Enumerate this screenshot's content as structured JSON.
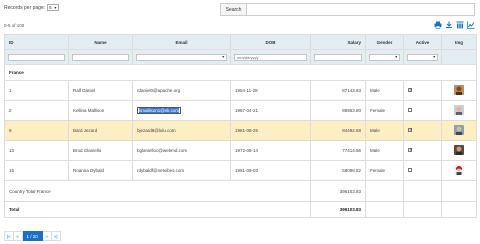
{
  "records_per_page": {
    "label": "Records per page:",
    "value": "5"
  },
  "search": {
    "button_label": "Search",
    "value": ""
  },
  "record_count": "0-5 of 100",
  "toolbar": {
    "icons": [
      "print-icon",
      "download-icon",
      "columns-icon",
      "chart-icon"
    ]
  },
  "columns": [
    "ID",
    "Name",
    "Email",
    "DOB",
    "Salary",
    "Gender",
    "Active",
    "Img"
  ],
  "filters": {
    "dob_placeholder": "mm/dd/yyyy"
  },
  "group": {
    "label": "France"
  },
  "rows": [
    {
      "id": "1",
      "name": "Ralf Daniel",
      "email": "rdaniel0@apache.org",
      "dob": "1954-11-28",
      "salary": "87143.83",
      "gender": "Male",
      "active": true
    },
    {
      "id": "2",
      "name": "Kellina Mallison",
      "email": "kmallison1@vk.com",
      "dob": "1987-04-21",
      "salary": "88953.80",
      "gender": "Female",
      "active": false
    },
    {
      "id": "9",
      "name": "Bard Jezard",
      "email": "bjezard8@lulu.com",
      "dob": "1981-08-25",
      "salary": "84492.69",
      "gender": "Male",
      "active": true
    },
    {
      "id": "13",
      "name": "Brod Glaniello",
      "email": "bglanielloc@webmd.com",
      "dob": "1972-08-14",
      "salary": "77414.56",
      "gender": "Male",
      "active": true
    },
    {
      "id": "16",
      "name": "Roanna Dybald",
      "email": "rdybaldf@netvibes.com",
      "dob": "1991-09-03",
      "salary": "58098.82",
      "gender": "Female",
      "active": false
    }
  ],
  "subtotal": {
    "label": "Country Total France",
    "value": "396103.83"
  },
  "total": {
    "label": "Total",
    "value": "396103.83"
  },
  "pager": {
    "first": "|«",
    "prev": "«",
    "current": "1 / 20",
    "next": "»",
    "last": "»|"
  },
  "colors": {
    "accent": "#1a6fc9",
    "header_bg": "#e4edf2",
    "highlight_row": "#fcefc4"
  }
}
